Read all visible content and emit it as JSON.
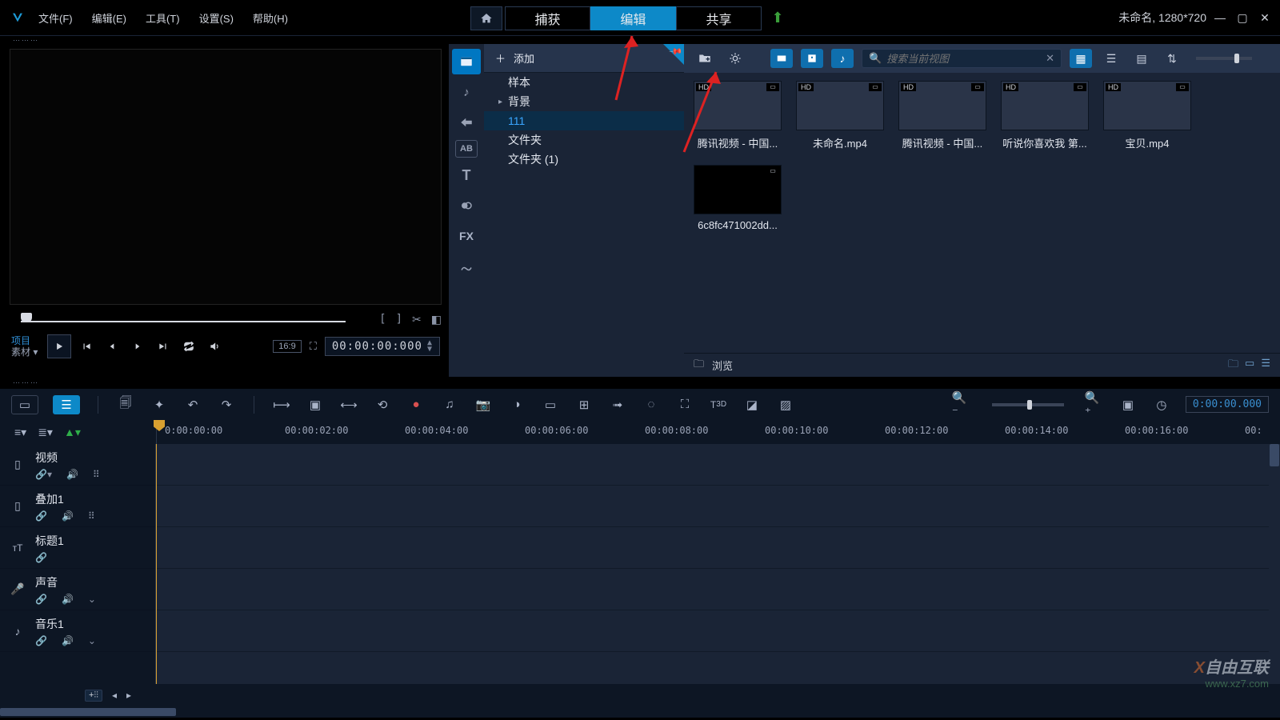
{
  "title_right": "未命名, 1280*720",
  "menus": {
    "file": "文件(F)",
    "edit": "编辑(E)",
    "tools": "工具(T)",
    "settings": "设置(S)",
    "help": "帮助(H)"
  },
  "mode_tabs": {
    "capture": "捕获",
    "edit": "编辑",
    "share": "共享"
  },
  "library": {
    "add_label": "添加",
    "tree": {
      "sample": "样本",
      "background": "背景",
      "f111": "111",
      "folder": "文件夹",
      "folder1": "文件夹 (1)"
    },
    "search_placeholder": "搜索当前视图",
    "browse": "浏览",
    "items": [
      {
        "caption": "腾讯视频 - 中国..."
      },
      {
        "caption": "未命名.mp4"
      },
      {
        "caption": "腾讯视频 - 中国..."
      },
      {
        "caption": "听说你喜欢我 第..."
      },
      {
        "caption": "宝贝.mp4"
      },
      {
        "caption": "6c8fc471002dd..."
      }
    ]
  },
  "preview": {
    "tab_project": "项目",
    "tab_material": "素材",
    "ratio": "16:9",
    "timecode": "00:00:00:000"
  },
  "timeline": {
    "zoom_timecode": "0:00:00.000",
    "ruler": [
      "0:00:00:00",
      "00:00:02:00",
      "00:00:04:00",
      "00:00:06:00",
      "00:00:08:00",
      "00:00:10:00",
      "00:00:12:00",
      "00:00:14:00",
      "00:00:16:00",
      "00:"
    ],
    "tracks": {
      "video": "视频",
      "overlay": "叠加1",
      "title": "标题1",
      "voice": "声音",
      "music": "音乐1"
    },
    "add_chip": "+⫶⫶"
  },
  "watermark": {
    "line1": "自由互联",
    "line2": "www.xz7.com"
  }
}
